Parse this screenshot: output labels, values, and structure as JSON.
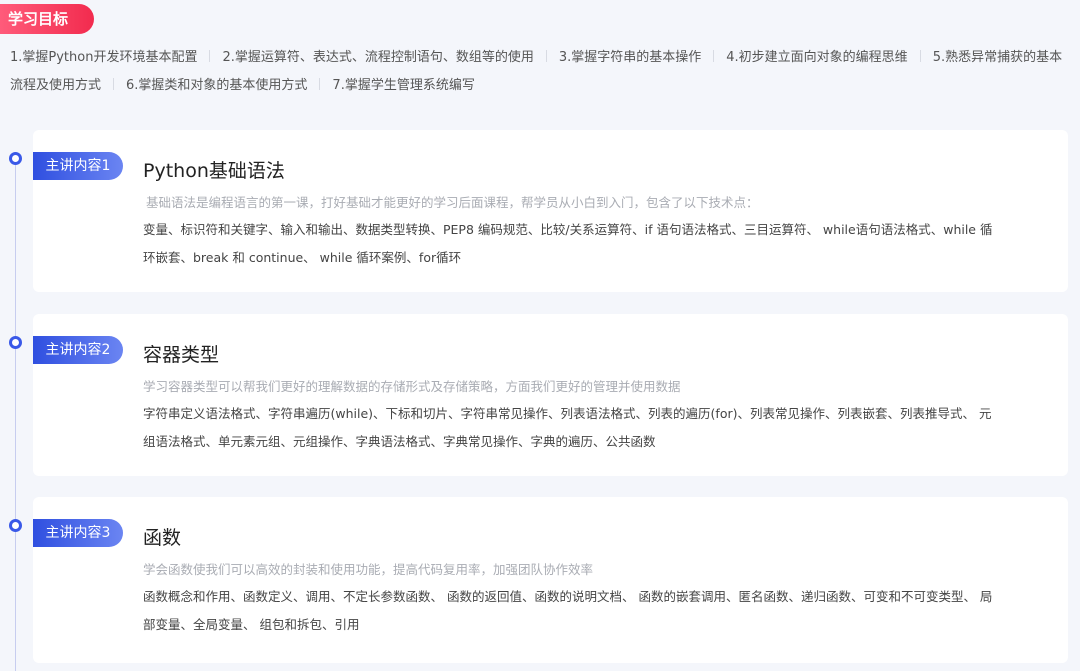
{
  "goals": {
    "badge": "学习目标",
    "items": [
      "1.掌握Python开发环境基本配置",
      "2.掌握运算符、表达式、流程控制语句、数组等的使用",
      "3.掌握字符串的基本操作",
      "4.初步建立面向对象的编程思维",
      "5.熟悉异常捕获的基本流程及使用方式",
      "6.掌握类和对象的基本使用方式",
      "7.掌握学生管理系统编写"
    ]
  },
  "modules": [
    {
      "tag": "主讲内容1",
      "title": "Python基础语法",
      "intro": "基础语法是编程语言的第一课，打好基础才能更好的学习后面课程，帮学员从小白到入门，包含了以下技术点：",
      "topics": "变量、标识符和关键字、输入和输出、数据类型转换、PEP8 编码规范、比较/关系运算符、if 语句语法格式、三目运算符、 while语句语法格式、while 循环嵌套、break 和 continue、 while 循环案例、for循环"
    },
    {
      "tag": "主讲内容2",
      "title": "容器类型",
      "intro": "学习容器类型可以帮我们更好的理解数据的存储形式及存储策略，方面我们更好的管理并使用数据",
      "topics": "字符串定义语法格式、字符串遍历(while)、下标和切片、字符串常见操作、列表语法格式、列表的遍历(for)、列表常见操作、列表嵌套、列表推导式、 元组语法格式、单元素元组、元组操作、字典语法格式、字典常见操作、字典的遍历、公共函数"
    },
    {
      "tag": "主讲内容3",
      "title": "函数",
      "intro": "学会函数使我们可以高效的封装和使用功能，提高代码复用率，加强团队协作效率",
      "topics": "函数概念和作用、函数定义、调用、不定长参数函数、 函数的返回值、函数的说明文档、 函数的嵌套调用、匿名函数、递归函数、可变和不可变类型、 局部变量、全局变量、 组包和拆包、引用"
    }
  ],
  "colors": {
    "goal_badge": "#f22b4e",
    "module_tag": "#2f4fe0",
    "timeline": "#3a59e8"
  }
}
